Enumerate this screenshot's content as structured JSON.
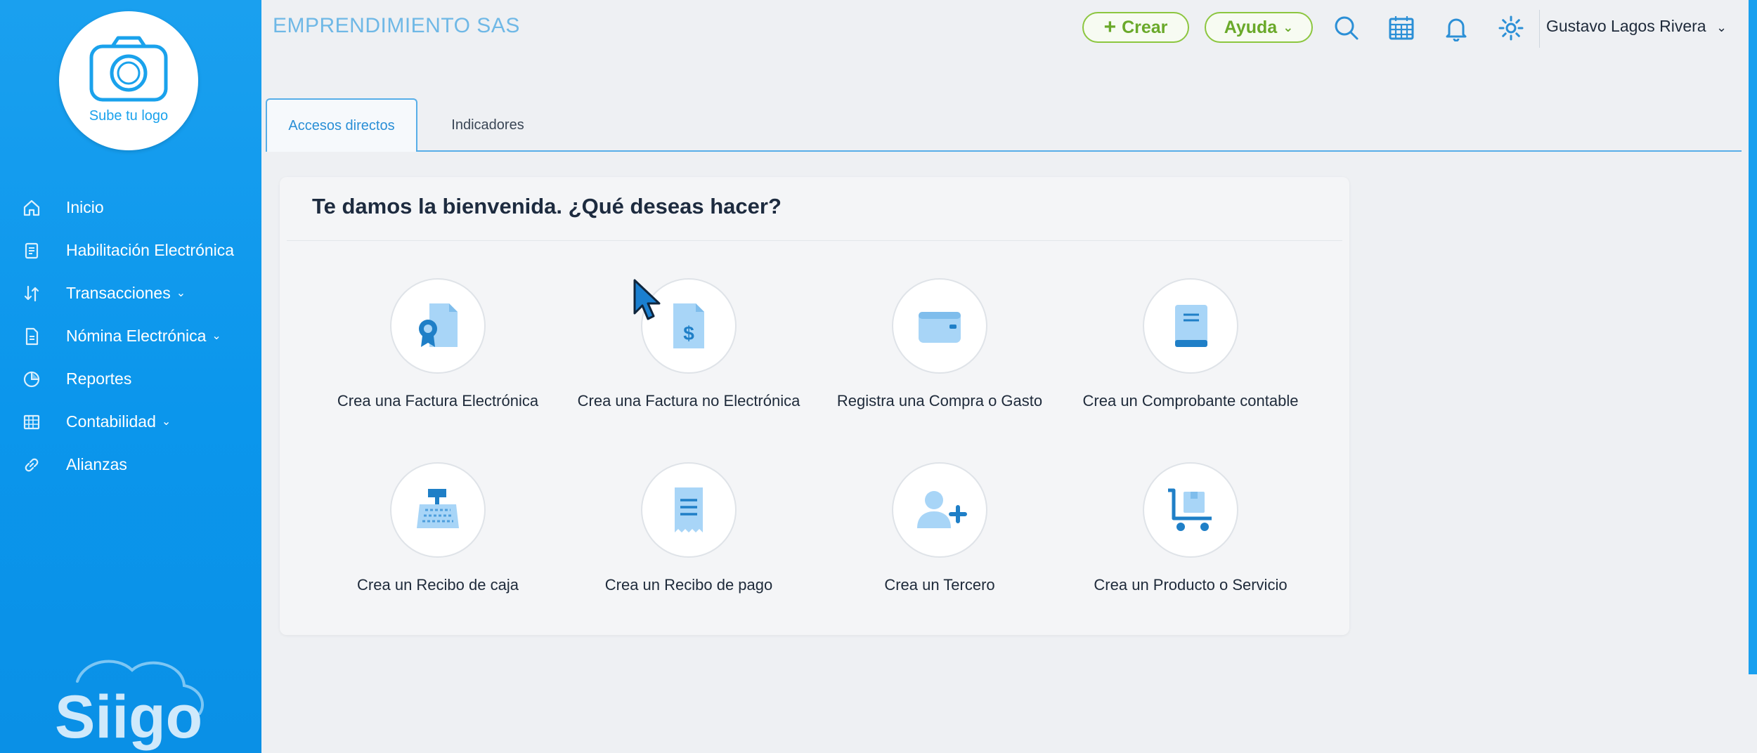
{
  "sidebar": {
    "logo_upload_text": "Sube tu logo",
    "items": [
      {
        "label": "Inicio",
        "icon": "home-icon",
        "has_submenu": false
      },
      {
        "label": "Habilitación Electrónica",
        "icon": "document-icon",
        "has_submenu": false
      },
      {
        "label": "Transacciones",
        "icon": "transactions-icon",
        "has_submenu": true
      },
      {
        "label": "Nómina Electrónica",
        "icon": "payroll-icon",
        "has_submenu": true
      },
      {
        "label": "Reportes",
        "icon": "reports-icon",
        "has_submenu": false
      },
      {
        "label": "Contabilidad",
        "icon": "accounting-icon",
        "has_submenu": true
      },
      {
        "label": "Alianzas",
        "icon": "link-icon",
        "has_submenu": false
      }
    ],
    "brand": "Siigo"
  },
  "header": {
    "company_name": "EMPRENDIMIENTO SAS",
    "create_label": "Crear",
    "help_label": "Ayuda",
    "user_name": "Gustavo Lagos Rivera"
  },
  "tabs": [
    {
      "label": "Accesos directos",
      "active": true
    },
    {
      "label": "Indicadores",
      "active": false
    }
  ],
  "welcome": {
    "title": "Te damos la bienvenida. ¿Qué deseas hacer?",
    "actions": [
      {
        "label": "Crea una Factura Electrónica",
        "icon": "electronic-invoice-icon"
      },
      {
        "label": "Crea una Factura no Electrónica",
        "icon": "invoice-dollar-icon"
      },
      {
        "label": "Registra una Compra o Gasto",
        "icon": "wallet-icon"
      },
      {
        "label": "Crea un Comprobante contable",
        "icon": "accounting-book-icon"
      },
      {
        "label": "Crea un Recibo de caja",
        "icon": "cash-register-icon"
      },
      {
        "label": "Crea un Recibo de pago",
        "icon": "receipt-icon"
      },
      {
        "label": "Crea un Tercero",
        "icon": "add-person-icon"
      },
      {
        "label": "Crea un Producto o Servicio",
        "icon": "product-cart-icon"
      }
    ]
  },
  "colors": {
    "sidebar_blue": "#0b96ec",
    "accent_green": "#8cc63f",
    "icon_blue": "#2b8fd6",
    "icon_light_blue": "#9fd0f5"
  }
}
